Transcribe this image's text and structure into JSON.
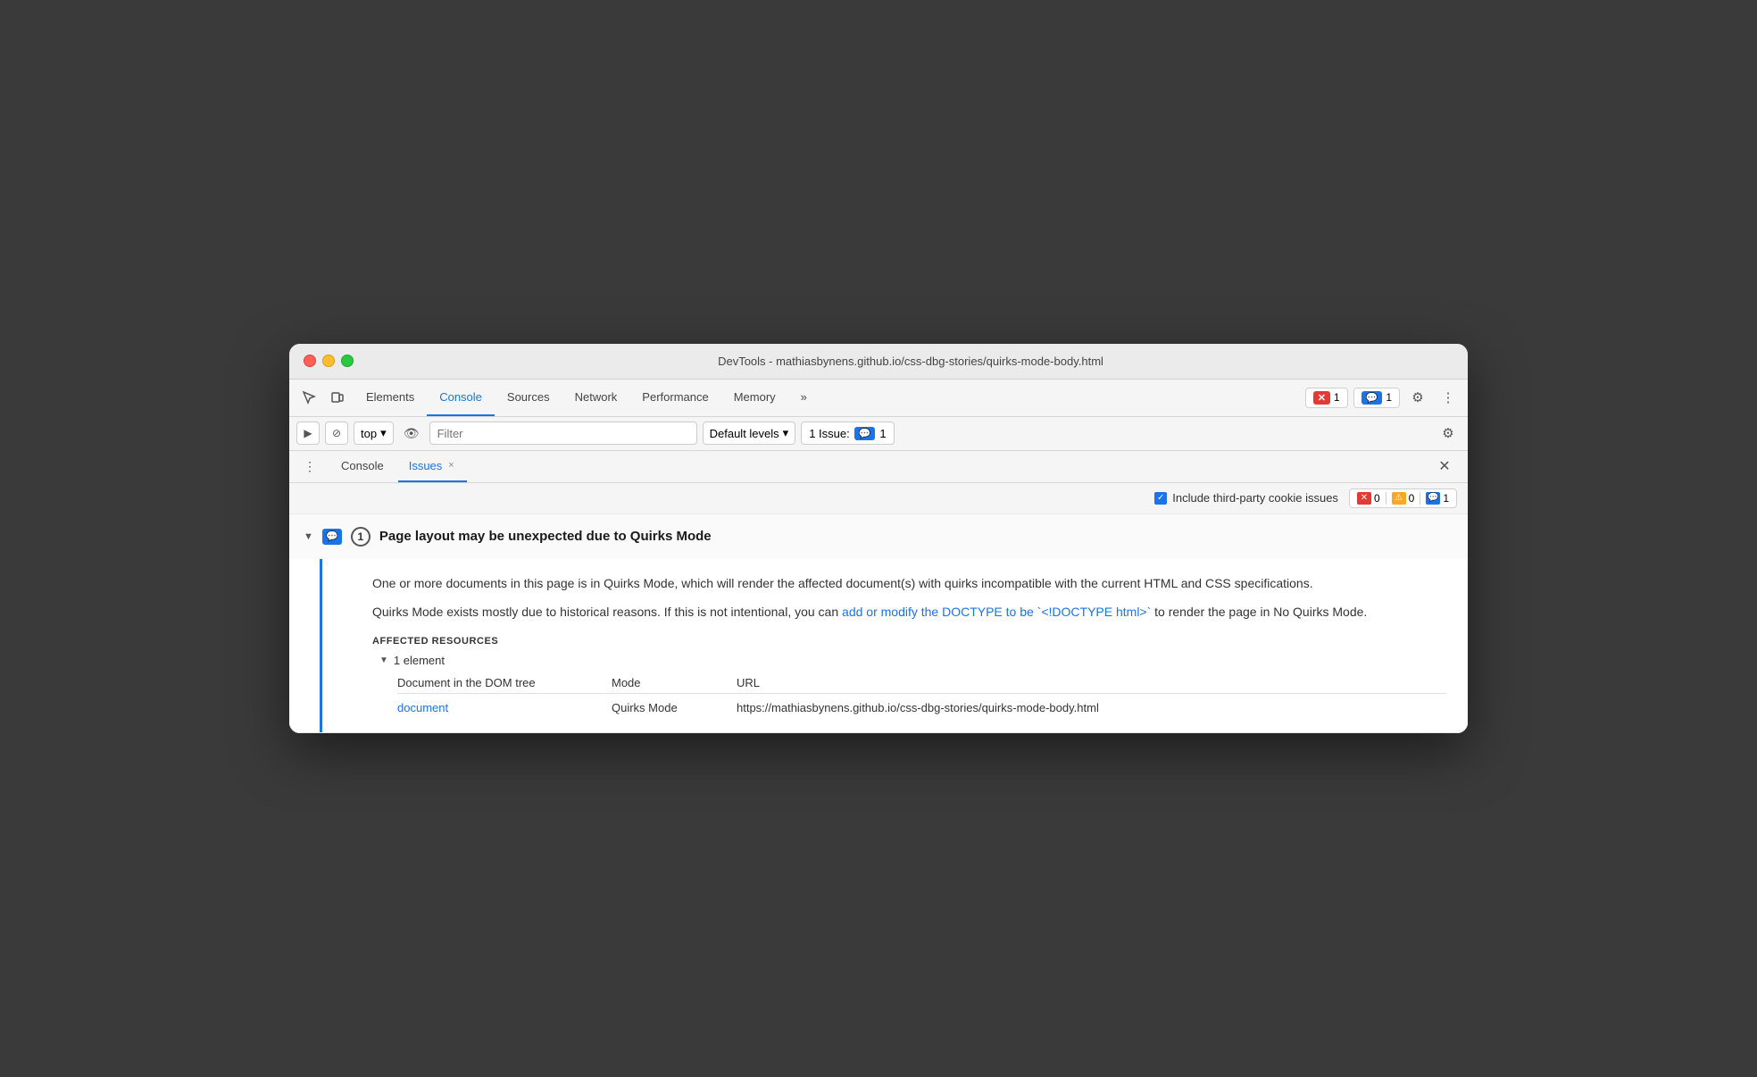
{
  "window": {
    "title": "DevTools - mathiasbynens.github.io/css-dbg-stories/quirks-mode-body.html"
  },
  "traffic_lights": {
    "red_label": "close",
    "yellow_label": "minimize",
    "green_label": "maximize"
  },
  "top_nav": {
    "tabs": [
      {
        "id": "elements",
        "label": "Elements",
        "active": false
      },
      {
        "id": "console",
        "label": "Console",
        "active": true
      },
      {
        "id": "sources",
        "label": "Sources",
        "active": false
      },
      {
        "id": "network",
        "label": "Network",
        "active": false
      },
      {
        "id": "performance",
        "label": "Performance",
        "active": false
      },
      {
        "id": "memory",
        "label": "Memory",
        "active": false
      }
    ],
    "more_label": "»",
    "error_count": "1",
    "message_count": "1",
    "settings_label": "⚙",
    "more_vert_label": "⋮"
  },
  "toolbar2": {
    "run_label": "▶",
    "clear_label": "🚫",
    "top_label": "top",
    "eye_label": "👁",
    "filter_placeholder": "Filter",
    "filter_value": "",
    "levels_label": "Default levels",
    "issue_label": "1 Issue:",
    "issue_count": "1",
    "settings_label": "⚙"
  },
  "sub_tabs": {
    "dots_label": "⋮",
    "tabs": [
      {
        "id": "console-tab",
        "label": "Console",
        "active": false,
        "closeable": false
      },
      {
        "id": "issues-tab",
        "label": "Issues",
        "active": true,
        "closeable": true
      }
    ],
    "close_label": "×"
  },
  "issues_filter_bar": {
    "checkbox_label": "Include third-party cookie issues",
    "error_count": "0",
    "warning_count": "0",
    "info_count": "1"
  },
  "issue_group": {
    "title": "Page layout may be unexpected due to Quirks Mode",
    "count": "1",
    "description_p1": "One or more documents in this page is in Quirks Mode, which will render the affected document(s) with quirks incompatible with the current HTML and CSS specifications.",
    "description_p2_before": "Quirks Mode exists mostly due to historical reasons. If this is not intentional, you can ",
    "description_link": "add or modify the DOCTYPE to be `<!DOCTYPE html>`",
    "description_p2_after": " to render the page in No Quirks Mode.",
    "affected_resources_label": "AFFECTED RESOURCES",
    "element_count_label": "1 element",
    "col_doc_label": "Document in the DOM tree",
    "col_mode_label": "Mode",
    "col_url_label": "URL",
    "row_doc_link": "document",
    "row_mode": "Quirks Mode",
    "row_url": "https://mathiasbynens.github.io/css-dbg-stories/quirks-mode-body.html"
  }
}
